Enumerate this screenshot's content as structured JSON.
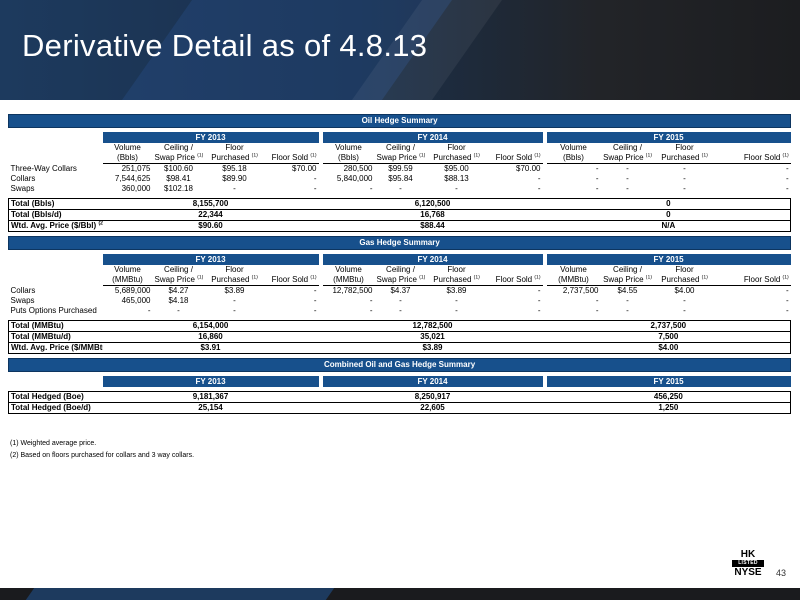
{
  "page": {
    "title": "Derivative Detail as of 4.8.13",
    "page_number": "43"
  },
  "logo": {
    "line1": "HK",
    "line2": "LISTED",
    "line3": "NYSE"
  },
  "oil": {
    "section_title": "Oil Hedge Summary",
    "fy": [
      "FY 2013",
      "FY 2014",
      "FY 2015"
    ],
    "cols": {
      "vol1": "Volume",
      "vol2": "(Bbls)",
      "ceil1": "Ceiling /",
      "ceil2": "Swap Price",
      "floor1": "Floor",
      "floor2": "Purchased",
      "sold": "Floor Sold",
      "fn": "(1)"
    },
    "rows": [
      {
        "label": "Three-Way Collars",
        "v": [
          "251,075",
          "$100.60",
          "$95.18",
          "$70.00",
          "280,500",
          "$99.59",
          "$95.00",
          "$70.00",
          "-",
          "-",
          "-",
          "-"
        ]
      },
      {
        "label": "Collars",
        "v": [
          "7,544,625",
          "$98.41",
          "$89.90",
          "-",
          "5,840,000",
          "$95.84",
          "$88.13",
          "-",
          "-",
          "-",
          "-",
          "-"
        ]
      },
      {
        "label": "Swaps",
        "v": [
          "360,000",
          "$102.18",
          "-",
          "-",
          "-",
          "-",
          "-",
          "-",
          "-",
          "-",
          "-",
          "-"
        ]
      }
    ],
    "totals": [
      {
        "label": "Total (Bbls)",
        "fn": "",
        "v": [
          "8,155,700",
          "6,120,500",
          "0"
        ]
      },
      {
        "label": "Total (Bbls/d)",
        "fn": "",
        "v": [
          "22,344",
          "16,768",
          "0"
        ]
      },
      {
        "label": "Wtd. Avg. Price ($/Bbl)",
        "fn": "(2)",
        "v": [
          "$90.60",
          "$88.44",
          "N/A"
        ]
      }
    ]
  },
  "gas": {
    "section_title": "Gas Hedge Summary",
    "fy": [
      "FY 2013",
      "FY 2014",
      "FY 2015"
    ],
    "cols": {
      "vol1": "Volume",
      "vol2": "(MMBtu)",
      "ceil1": "Ceiling /",
      "ceil2": "Swap Price",
      "floor1": "Floor",
      "floor2": "Purchased",
      "sold": "Floor Sold",
      "fn": "(1)"
    },
    "rows": [
      {
        "label": "Collars",
        "v": [
          "5,689,000",
          "$4.27",
          "$3.89",
          "-",
          "12,782,500",
          "$4.37",
          "$3.89",
          "-",
          "2,737,500",
          "$4.55",
          "$4.00",
          "-"
        ]
      },
      {
        "label": "Swaps",
        "v": [
          "465,000",
          "$4.18",
          "-",
          "-",
          "-",
          "-",
          "-",
          "-",
          "-",
          "-",
          "-",
          "-"
        ]
      },
      {
        "label": "Puts Options Purchased",
        "v": [
          "-",
          "-",
          "-",
          "-",
          "-",
          "-",
          "-",
          "-",
          "-",
          "-",
          "-",
          "-"
        ]
      }
    ],
    "totals": [
      {
        "label": "Total (MMBtu)",
        "fn": "",
        "v": [
          "6,154,000",
          "12,782,500",
          "2,737,500"
        ]
      },
      {
        "label": "Total (MMBtu/d)",
        "fn": "",
        "v": [
          "16,860",
          "35,021",
          "7,500"
        ]
      },
      {
        "label": "Wtd. Avg. Price ($/MMBtu",
        "fn": "",
        "v": [
          "$3.91",
          "$3.89",
          "$4.00"
        ]
      }
    ]
  },
  "combined": {
    "section_title": "Combined Oil and Gas Hedge Summary",
    "fy": [
      "FY 2013",
      "FY 2014",
      "FY 2015"
    ],
    "totals": [
      {
        "label": "Total Hedged (Boe)",
        "fn": "",
        "v": [
          "9,181,367",
          "8,250,917",
          "456,250"
        ]
      },
      {
        "label": "Total Hedged (Boe/d)",
        "fn": "",
        "v": [
          "25,154",
          "22,605",
          "1,250"
        ]
      }
    ]
  },
  "footnotes": [
    "(1) Weighted average price.",
    "(2) Based on floors purchased for collars and 3 way collars."
  ]
}
